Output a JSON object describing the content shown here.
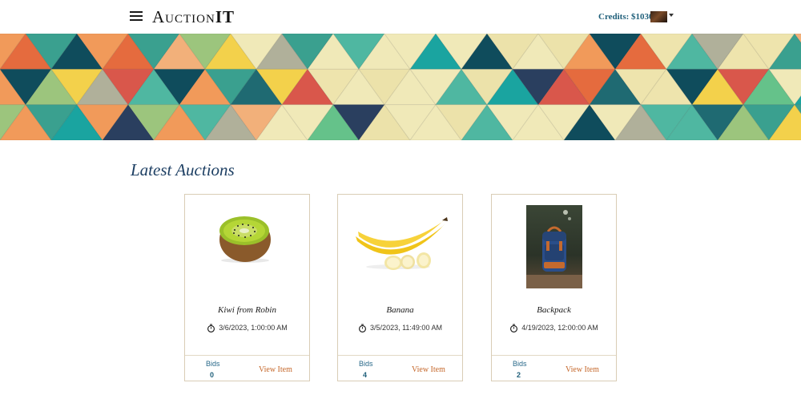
{
  "header": {
    "brand_main": "Auction",
    "brand_accent": "IT",
    "credits": "Credits: $1030",
    "menu_icon": "hamburger-icon",
    "avatar_icon": "user-avatar"
  },
  "main": {
    "section_title": "Latest Auctions"
  },
  "auctions": [
    {
      "title": "Kiwi from Robin",
      "end_time": "3/6/2023, 1:00:00 AM",
      "bids_label": "Bids",
      "bids": "0",
      "action": "View Item",
      "image_icon": "kiwi-image"
    },
    {
      "title": "Banana",
      "end_time": "3/5/2023, 11:49:00 AM",
      "bids_label": "Bids",
      "bids": "4",
      "action": "View Item",
      "image_icon": "banana-image"
    },
    {
      "title": "Backpack",
      "end_time": "4/19/2023, 12:00:00 AM",
      "bids_label": "Bids",
      "bids": "2",
      "action": "View Item",
      "image_icon": "backpack-image"
    }
  ],
  "colors": {
    "accent_teal": "#1f5f7a",
    "title_navy": "#1d3f63",
    "link_orange": "#c5672a",
    "card_border": "#d9cdb6"
  }
}
